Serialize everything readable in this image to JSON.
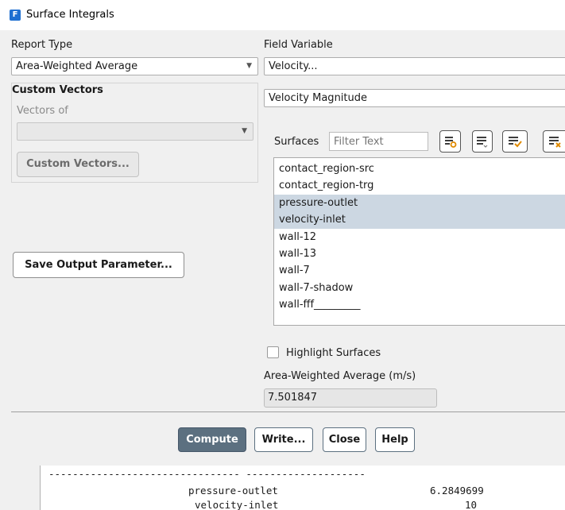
{
  "window": {
    "title": "Surface Integrals",
    "app_icon_letter": "F"
  },
  "report_type": {
    "label": "Report Type",
    "value": "Area-Weighted Average"
  },
  "field_variable": {
    "label": "Field Variable",
    "category": "Velocity...",
    "quantity": "Velocity Magnitude"
  },
  "custom_vectors": {
    "heading": "Custom Vectors",
    "vectors_of_label": "Vectors of",
    "vectors_of_value": "",
    "button_label": "Custom Vectors..."
  },
  "save_output_button": "Save Output Parameter...",
  "surfaces": {
    "label": "Surfaces",
    "filter_placeholder": "Filter Text",
    "items": [
      {
        "label": "contact_region-src",
        "selected": false
      },
      {
        "label": "contact_region-trg",
        "selected": false
      },
      {
        "label": "pressure-outlet",
        "selected": true
      },
      {
        "label": "velocity-inlet",
        "selected": true
      },
      {
        "label": "wall-12",
        "selected": false
      },
      {
        "label": "wall-13",
        "selected": false
      },
      {
        "label": "wall-7",
        "selected": false
      },
      {
        "label": "wall-7-shadow",
        "selected": false
      },
      {
        "label": "wall-fff_________",
        "selected": false
      }
    ]
  },
  "highlight_surfaces": {
    "label": "Highlight Surfaces",
    "checked": false
  },
  "result": {
    "label": "Area-Weighted Average (m/s)",
    "value": "7.501847"
  },
  "buttons": {
    "compute": "Compute",
    "write": "Write...",
    "close": "Close",
    "help": "Help"
  },
  "console": {
    "separator_line": "-------------------------------- --------------------",
    "rows": [
      {
        "name": "pressure-outlet",
        "value": "6.2849699"
      },
      {
        "name": "velocity-inlet",
        "value": "10"
      }
    ]
  },
  "colors": {
    "selection": "#ccd7e2",
    "compute_button": "#5c7080",
    "app_icon": "#1f6fd1"
  }
}
